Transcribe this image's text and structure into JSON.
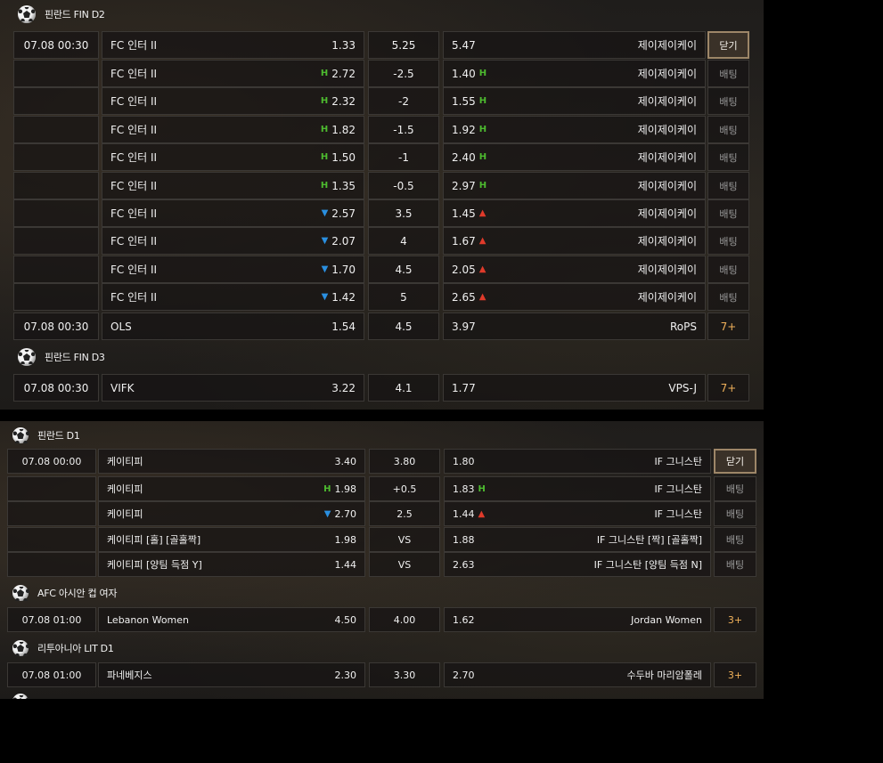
{
  "icons": {
    "league": "soccer-ball-icon",
    "higher": "h-marker-icon",
    "up": "arrow-up-icon",
    "down": "arrow-down-icon"
  },
  "colors": {
    "higher": "#4dbb2f",
    "up": "#e03a2a",
    "down": "#2a8fe0",
    "more": "#f0b15a",
    "close_border": "#9d8668"
  },
  "panel1": {
    "leagues": [
      {
        "name": "핀란드 FIN D2",
        "rows": [
          {
            "time": "07.08 00:30",
            "home": "FC 인터 II",
            "home_odds": "1.33",
            "home_ind": "",
            "mid": "5.25",
            "away_odds": "5.47",
            "away_ind": "",
            "away": "제이제이케이",
            "btn": "닫기",
            "btn_type": "close"
          },
          {
            "time": "",
            "home": "FC 인터 II",
            "home_odds": "2.72",
            "home_ind": "H",
            "mid": "-2.5",
            "away_odds": "1.40",
            "away_ind": "H",
            "away": "제이제이케이",
            "btn": "배팅",
            "btn_type": "bet"
          },
          {
            "time": "",
            "home": "FC 인터 II",
            "home_odds": "2.32",
            "home_ind": "H",
            "mid": "-2",
            "away_odds": "1.55",
            "away_ind": "H",
            "away": "제이제이케이",
            "btn": "배팅",
            "btn_type": "bet"
          },
          {
            "time": "",
            "home": "FC 인터 II",
            "home_odds": "1.82",
            "home_ind": "H",
            "mid": "-1.5",
            "away_odds": "1.92",
            "away_ind": "H",
            "away": "제이제이케이",
            "btn": "배팅",
            "btn_type": "bet"
          },
          {
            "time": "",
            "home": "FC 인터 II",
            "home_odds": "1.50",
            "home_ind": "H",
            "mid": "-1",
            "away_odds": "2.40",
            "away_ind": "H",
            "away": "제이제이케이",
            "btn": "배팅",
            "btn_type": "bet"
          },
          {
            "time": "",
            "home": "FC 인터 II",
            "home_odds": "1.35",
            "home_ind": "H",
            "mid": "-0.5",
            "away_odds": "2.97",
            "away_ind": "H",
            "away": "제이제이케이",
            "btn": "배팅",
            "btn_type": "bet"
          },
          {
            "time": "",
            "home": "FC 인터 II",
            "home_odds": "2.57",
            "home_ind": "down",
            "mid": "3.5",
            "away_odds": "1.45",
            "away_ind": "up",
            "away": "제이제이케이",
            "btn": "배팅",
            "btn_type": "bet"
          },
          {
            "time": "",
            "home": "FC 인터 II",
            "home_odds": "2.07",
            "home_ind": "down",
            "mid": "4",
            "away_odds": "1.67",
            "away_ind": "up",
            "away": "제이제이케이",
            "btn": "배팅",
            "btn_type": "bet"
          },
          {
            "time": "",
            "home": "FC 인터 II",
            "home_odds": "1.70",
            "home_ind": "down",
            "mid": "4.5",
            "away_odds": "2.05",
            "away_ind": "up",
            "away": "제이제이케이",
            "btn": "배팅",
            "btn_type": "bet"
          },
          {
            "time": "",
            "home": "FC 인터 II",
            "home_odds": "1.42",
            "home_ind": "down",
            "mid": "5",
            "away_odds": "2.65",
            "away_ind": "up",
            "away": "제이제이케이",
            "btn": "배팅",
            "btn_type": "bet"
          },
          {
            "time": "07.08 00:30",
            "home": "OLS",
            "home_odds": "1.54",
            "home_ind": "",
            "mid": "4.5",
            "away_odds": "3.97",
            "away_ind": "",
            "away": "RoPS",
            "btn": "7+",
            "btn_type": "more"
          }
        ]
      },
      {
        "name": "핀란드 FIN D3",
        "rows": [
          {
            "time": "07.08 00:30",
            "home": "VIFK",
            "home_odds": "3.22",
            "home_ind": "",
            "mid": "4.1",
            "away_odds": "1.77",
            "away_ind": "",
            "away": "VPS-J",
            "btn": "7+",
            "btn_type": "more"
          }
        ]
      }
    ]
  },
  "panel2": {
    "leagues": [
      {
        "name": "핀란드 D1",
        "rows": [
          {
            "time": "07.08 00:00",
            "home": "케이티피",
            "home_odds": "3.40",
            "home_ind": "",
            "mid": "3.80",
            "away_odds": "1.80",
            "away_ind": "",
            "away": "IF 그니스탄",
            "btn": "닫기",
            "btn_type": "close"
          },
          {
            "time": "",
            "home": "케이티피",
            "home_odds": "1.98",
            "home_ind": "H",
            "mid": "+0.5",
            "away_odds": "1.83",
            "away_ind": "H",
            "away": "IF 그니스탄",
            "btn": "배팅",
            "btn_type": "bet"
          },
          {
            "time": "",
            "home": "케이티피",
            "home_odds": "2.70",
            "home_ind": "down",
            "mid": "2.5",
            "away_odds": "1.44",
            "away_ind": "up",
            "away": "IF 그니스탄",
            "btn": "배팅",
            "btn_type": "bet"
          },
          {
            "time": "",
            "home": "케이티피 [홀] [골홀짝]",
            "home_odds": "1.98",
            "home_ind": "",
            "mid": "VS",
            "away_odds": "1.88",
            "away_ind": "",
            "away": "IF 그니스탄 [짝] [골홀짝]",
            "btn": "배팅",
            "btn_type": "bet"
          },
          {
            "time": "",
            "home": "케이티피 [양팀 득점 Y]",
            "home_odds": "1.44",
            "home_ind": "",
            "mid": "VS",
            "away_odds": "2.63",
            "away_ind": "",
            "away": "IF 그니스탄 [양팀 득점 N]",
            "btn": "배팅",
            "btn_type": "bet"
          }
        ]
      },
      {
        "name": "AFC 아시안 컵 여자",
        "rows": [
          {
            "time": "07.08 01:00",
            "home": "Lebanon Women",
            "home_odds": "4.50",
            "home_ind": "",
            "mid": "4.00",
            "away_odds": "1.62",
            "away_ind": "",
            "away": "Jordan Women",
            "btn": "3+",
            "btn_type": "more"
          }
        ]
      },
      {
        "name": "리투아니아 LIT D1",
        "rows": [
          {
            "time": "07.08 01:00",
            "home": "파네베지스",
            "home_odds": "2.30",
            "home_ind": "",
            "mid": "3.30",
            "away_odds": "2.70",
            "away_ind": "",
            "away": "수두바 마리암폴레",
            "btn": "3+",
            "btn_type": "more"
          }
        ]
      }
    ]
  }
}
